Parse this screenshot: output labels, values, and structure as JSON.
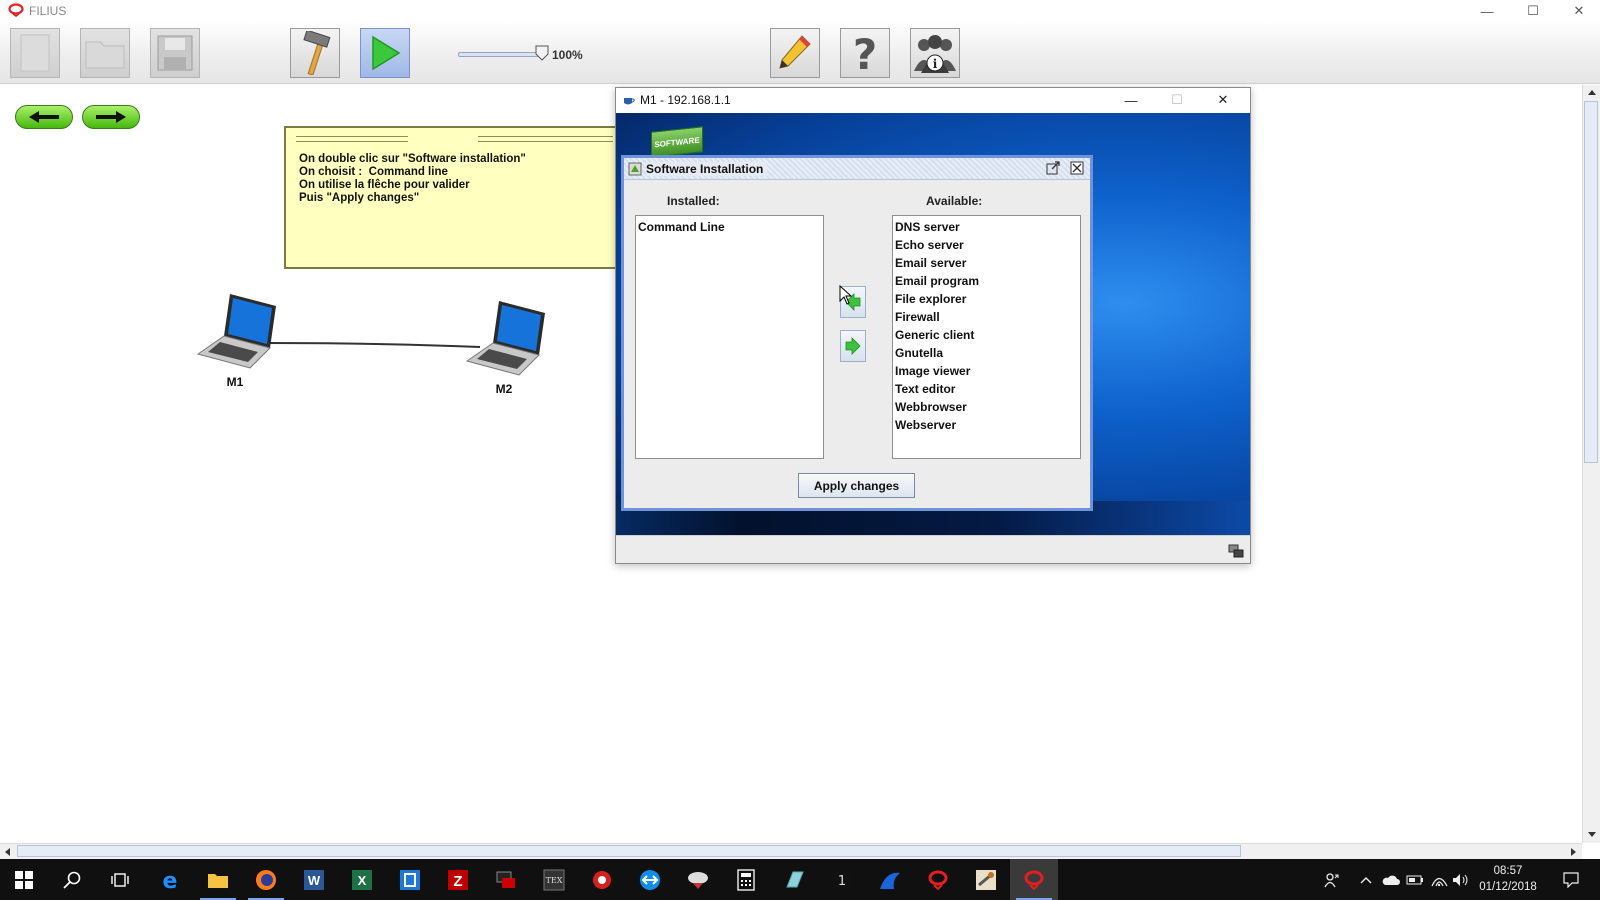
{
  "app": {
    "title": "FILIUS"
  },
  "window_controls": {
    "minimize": "—",
    "maximize": "☐",
    "close": "✕"
  },
  "toolbar": {
    "buttons": [
      "new-file",
      "open-folder",
      "save",
      "design-mode-hammer",
      "simulation-play",
      "edit-pencil",
      "help",
      "info"
    ],
    "zoom": {
      "value_label": "100%",
      "level_percent": 100
    }
  },
  "note": {
    "text": "On double clic sur \"Software installation\"\nOn choisit :  Command line\nOn utilise la flêche pour valider\nPuis \"Apply changes\""
  },
  "nodes": [
    {
      "label": "M1"
    },
    {
      "label": "M2"
    }
  ],
  "host_window": {
    "title": "M1 - 192.168.1.1",
    "desktop_icon_label": "SOFTWARE",
    "controls": {
      "minimize": "—",
      "maximize": "☐",
      "close": "✕"
    }
  },
  "software_dialog": {
    "title": "Software Installation",
    "installed_label": "Installed:",
    "available_label": "Available:",
    "installed": [
      "Command Line"
    ],
    "available": [
      "DNS server",
      "Echo server",
      "Email server",
      "Email program",
      "File explorer",
      "Firewall",
      "Generic client",
      "Gnutella",
      "Image viewer",
      "Text editor",
      "Webbrowser",
      "Webserver"
    ],
    "apply_label": "Apply changes"
  },
  "taskbar": {
    "apps": [
      "windows-start",
      "search",
      "task-view",
      "edge",
      "file-explorer",
      "firefox",
      "word",
      "excel",
      "vscode-like",
      "filezilla",
      "app-dark",
      "tex-app",
      "app-red",
      "teamviewer",
      "app-bird",
      "calculator",
      "app-prism",
      "app-1",
      "app-blue",
      "filius-red",
      "app-gimp",
      "filius-running"
    ],
    "clock": {
      "time": "08:57",
      "date": "01/12/2018"
    }
  },
  "colors": {
    "accent": "#6f93d6",
    "note_bg": "#ffffc0",
    "nav_green": "#46b80e",
    "taskbar": "#101010"
  }
}
